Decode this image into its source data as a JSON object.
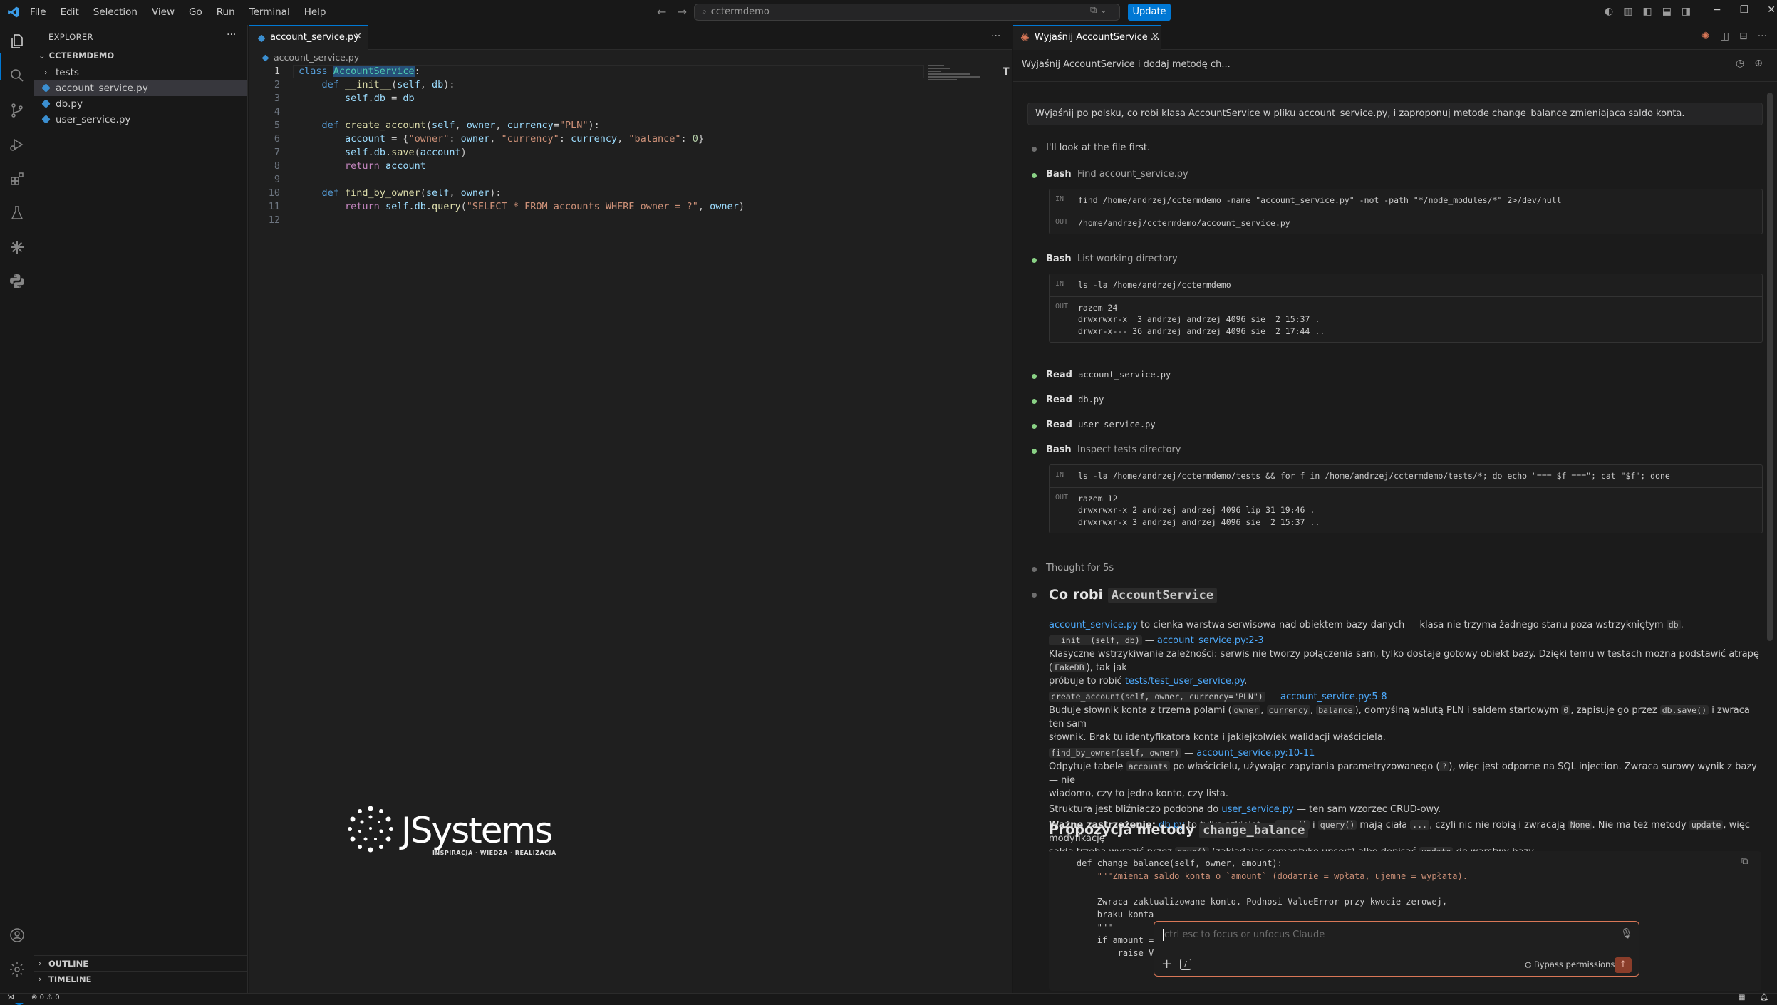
{
  "titlebar": {
    "menu": [
      "File",
      "Edit",
      "Selection",
      "View",
      "Go",
      "Run",
      "Terminal",
      "Help"
    ],
    "search": "cctermdemo",
    "update_label": "Update"
  },
  "sidebar": {
    "title": "EXPLORER",
    "root": "CCTERMDEMO",
    "items": [
      {
        "label": "tests",
        "type": "folder"
      },
      {
        "label": "account_service.py",
        "type": "python"
      },
      {
        "label": "db.py",
        "type": "python"
      },
      {
        "label": "user_service.py",
        "type": "python"
      }
    ],
    "outline": "OUTLINE",
    "timeline": "TIMELINE"
  },
  "editor": {
    "tab_label": "account_service.py",
    "breadcrumb": "account_service.py",
    "line_numbers": [
      "1",
      "2",
      "3",
      "4",
      "5",
      "6",
      "7",
      "8",
      "9",
      "10",
      "11",
      "12"
    ],
    "code": [
      "class AccountService:",
      "    def __init__(self, db):",
      "        self.db = db",
      "",
      "    def create_account(self, owner, currency=\"PLN\"):",
      "        account = {\"owner\": owner, \"currency\": currency, \"balance\": 0}",
      "        self.db.save(account)",
      "        return account",
      "",
      "    def find_by_owner(self, owner):",
      "        return self.db.query(\"SELECT * FROM accounts WHERE owner = ?\", owner)",
      ""
    ],
    "logo_text": "JSystems",
    "logo_tagline": "INSPIRACJA · WIEDZA · REALIZACJA"
  },
  "chat": {
    "tab_label": "Wyjaśnij AccountService ...",
    "title": "Wyjaśnij AccountService i dodaj metodę ch...",
    "user_message": "Wyjaśnij po polsku, co robi klasa AccountService w pliku account_service.py, i zaproponuj metode change_balance zmieniajaca saldo konta.",
    "look_text": "I'll look at the file first.",
    "steps": [
      {
        "tool": "Bash",
        "desc": "Find account_service.py"
      },
      {
        "tool": "Bash",
        "desc": "List working directory"
      },
      {
        "tool": "Read",
        "desc": "account_service.py"
      },
      {
        "tool": "Read",
        "desc": "db.py"
      },
      {
        "tool": "Read",
        "desc": "user_service.py"
      },
      {
        "tool": "Bash",
        "desc": "Inspect tests directory"
      }
    ],
    "io": {
      "in_tag": "IN",
      "out_tag": "OUT",
      "find_in": "find /home/andrzej/cctermdemo -name \"account_service.py\" -not -path \"*/node_modules/*\" 2>/dev/null",
      "find_out": "/home/andrzej/cctermdemo/account_service.py",
      "ls_in": "ls -la /home/andrzej/cctermdemo",
      "ls_out": [
        "razem 24",
        "drwxrwxr-x  3 andrzej andrzej 4096 sie  2 15:37 .",
        "drwxr-x--- 36 andrzej andrzej 4096 sie  2 17:44 .."
      ],
      "tests_in": "ls -la /home/andrzej/cctermdemo/tests && for f in /home/andrzej/cctermdemo/tests/*; do echo \"=== $f ===\"; cat \"$f\"; done",
      "tests_out": [
        "razem 12",
        "drwxrwxr-x 2 andrzej andrzej 4096 lip 31 19:46 .",
        "drwxrwxr-x 3 andrzej andrzej 4096 sie  2 15:37 .."
      ]
    },
    "thought": "Thought for 5s",
    "heading1_prefix": "Co robi",
    "heading1_code": "AccountService",
    "heading2_prefix": "Propozycja metody",
    "heading2_code": "change_balance",
    "resp": {
      "p1_link": "account_service.py",
      "p1_text": "to cienka warstwa serwisowa nad obiektem bazy danych — klasa nie trzyma żadnego stanu poza wstrzykniętym",
      "p1_code": "db",
      "init_sig": "__init__(self, db)",
      "init_link": "account_service.py:2-3",
      "init_desc_a": "Klasyczne wstrzykiwanie zależności: serwis nie tworzy połączenia sam, tylko dostaje gotowy obiekt bazy. Dzięki temu w testach można podstawić atrapę (",
      "init_desc_code": "FakeDB",
      "init_desc_b": "), tak jak",
      "init_desc_c": "próbuje to robić",
      "init_desc_link": "tests/test_user_service.py",
      "create_sig": "create_account(self, owner, currency=\"PLN\")",
      "create_link": "account_service.py:5-8",
      "create_desc_a": "Buduje słownik konta z trzema polami (",
      "create_c1": "owner",
      "create_c2": "currency",
      "create_c3": "balance",
      "create_desc_b": "), domyślną walutą PLN i saldem startowym",
      "create_c4": "0",
      "create_desc_c": ", zapisuje go przez",
      "create_c5": "db.save()",
      "create_desc_d": "i zwraca ten sam",
      "create_desc_e": "słownik. Brak tu identyfikatora konta i jakiejkolwiek walidacji właściciela.",
      "find_sig": "find_by_owner(self, owner)",
      "find_link": "account_service.py:10-11",
      "find_desc_a": "Odpytuje tabelę",
      "find_c1": "accounts",
      "find_desc_b": "po właścicielu, używając zapytania parametryzowanego (",
      "find_c2": "?",
      "find_desc_c": "), więc jest odporne na SQL injection. Zwraca surowy wynik z bazy — nie",
      "find_desc_d": "wiadomo, czy to jedno konto, czy lista.",
      "struct_a": "Struktura jest bliźniaczo podobna do",
      "struct_link": "user_service.py",
      "struct_b": "— ten sam wzorzec CRUD-owy.",
      "warn_bold": "Ważne zastrzeżenie:",
      "warn_link": "db.py",
      "warn_a": "to tylko szkielet —",
      "warn_c1": "save()",
      "warn_b": "i",
      "warn_c2": "query()",
      "warn_c": "mają ciała",
      "warn_c3": "...",
      "warn_d": ", czyli nic nie robią i zwracają",
      "warn_c4": "None",
      "warn_e": ". Nie ma też metody",
      "warn_c5": "update",
      "warn_f": ", więc modyfikację",
      "warn_g": "salda trzeba wyrazić przez",
      "warn_c6": "save()",
      "warn_h": "(zakładając semantykę upsert) albo dopisać",
      "warn_c7": "update",
      "warn_i": "do warstwy bazy."
    },
    "code_block": [
      "    def change_balance(self, owner, amount):",
      "        \"\"\"Zmienia saldo konta o `amount` (dodatnie = wpłata, ujemne = wypłata).",
      "",
      "        Zwraca zaktualizowane konto. Podnosi ValueError przy kwocie zerowej,",
      "        braku konta",
      "        \"\"\"",
      "        if amount =",
      "            raise V"
    ],
    "input_placeholder": "ctrl esc to focus or unfocus Claude",
    "bypass_label": "Bypass permissions"
  },
  "status": {
    "errors": "0",
    "warnings": "0",
    "notif_badge": "1"
  }
}
